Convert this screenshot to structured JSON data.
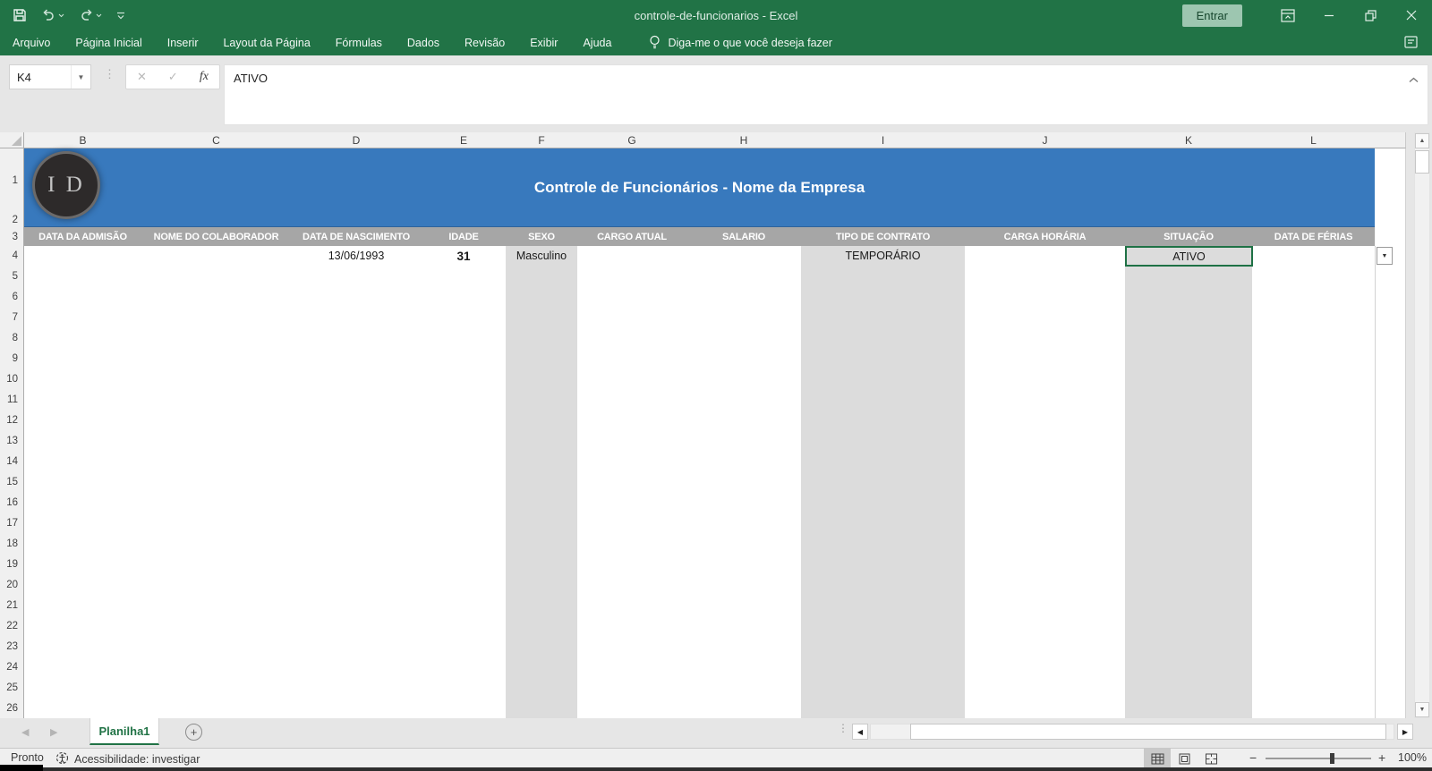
{
  "title_bar": {
    "title": "controle-de-funcionarios - Excel",
    "entrar_label": "Entrar"
  },
  "menu": {
    "tabs": [
      "Arquivo",
      "Página Inicial",
      "Inserir",
      "Layout da Página",
      "Fórmulas",
      "Dados",
      "Revisão",
      "Exibir",
      "Ajuda"
    ],
    "tell_me": "Diga-me o que você deseja fazer"
  },
  "formula_bar": {
    "name_box": "K4",
    "fx_label": "fx",
    "content": "ATIVO"
  },
  "grid": {
    "column_letters": [
      "B",
      "C",
      "D",
      "E",
      "F",
      "G",
      "H",
      "I",
      "J",
      "K",
      "L"
    ],
    "row_numbers": [
      1,
      2,
      3,
      4,
      5,
      6,
      7,
      8,
      9,
      10,
      11,
      12,
      13,
      14,
      15,
      16,
      17,
      18,
      19,
      20,
      21,
      22,
      23,
      24,
      25,
      26
    ],
    "banner": {
      "title": "Controle de Funcionários - Nome da Empresa",
      "logo_text": "I D",
      "color": "#3879BD"
    },
    "header_cells": [
      "DATA DA ADMISÃO",
      "NOME DO COLABORADOR",
      "DATA DE NASCIMENTO",
      "IDADE",
      "SEXO",
      "CARGO ATUAL",
      "SALARIO",
      "TIPO DE CONTRATO",
      "CARGA HORÁRIA",
      "SITUAÇÃO",
      "DATA DE FÉRIAS"
    ],
    "data_row": {
      "D": "13/06/1993",
      "E": "31",
      "F": "Masculino",
      "I": "TEMPORÁRIO",
      "K": "ATIVO"
    },
    "shaded_columns": [
      "F",
      "I",
      "K"
    ],
    "active_cell": {
      "column": "K",
      "row": 4,
      "value": "ATIVO"
    },
    "colors": {
      "table_header_gray": "#A6A6A6",
      "shaded_cell_gray": "#DCDCDC",
      "selection_green": "#1E7145"
    }
  },
  "sheet_bar": {
    "tab_label": "Planilha1"
  },
  "status_bar": {
    "status": "Pronto",
    "accessibility": "Acessibilidade: investigar",
    "zoom_level": "100%"
  },
  "theme": {
    "excel_green": "#217346"
  }
}
